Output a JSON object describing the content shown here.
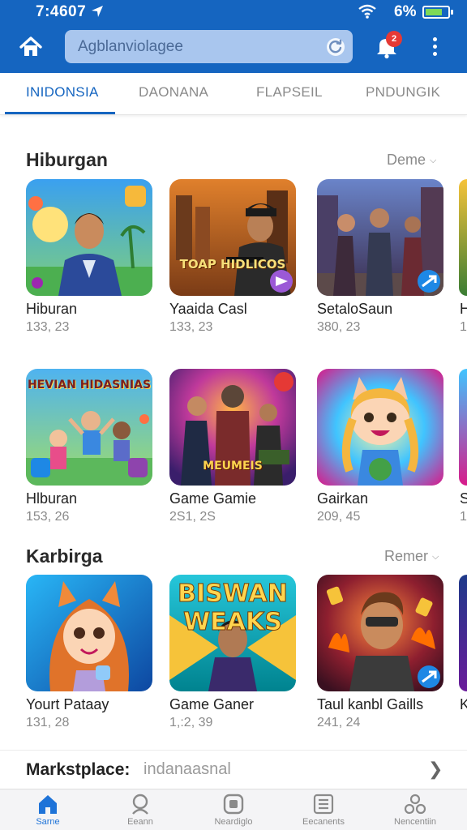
{
  "status": {
    "time": "7:4607",
    "battery": "6%"
  },
  "header": {
    "search_placeholder": "Agblanviolagee",
    "notification_count": "2"
  },
  "tabs": [
    {
      "label": "INIDONSIA",
      "active": true
    },
    {
      "label": "DAONANA",
      "active": false
    },
    {
      "label": "FLAPSEIL",
      "active": false
    },
    {
      "label": "PNDUNGIK",
      "active": false
    }
  ],
  "sections": [
    {
      "title": "Hiburgan",
      "more": "Deme",
      "rows": [
        [
          {
            "name": "Hiburan",
            "stat": "133, 23",
            "art": "man-suit-beach"
          },
          {
            "name": "Yaaida Casl",
            "stat": "133, 23",
            "art": "city-gunman",
            "overlay": "TOAP HIDLICOS"
          },
          {
            "name": "SetaloSaun",
            "stat": "380, 23",
            "art": "street-crew"
          }
        ],
        [
          {
            "name": "Hlburan",
            "stat": "153, 26",
            "art": "kids-cartoon",
            "overlay": "HEVIAN HIDASNIAS"
          },
          {
            "name": "Game Gamie",
            "stat": "2S1, 2S",
            "art": "action-squad",
            "overlay": "MEUMEIS"
          },
          {
            "name": "Gairkan",
            "stat": "209, 45",
            "art": "cat-girl"
          }
        ]
      ]
    },
    {
      "title": "Karbirga",
      "more": "Remer",
      "rows": [
        [
          {
            "name": "Yourt Pataay",
            "stat": "131, 28",
            "art": "fox-girl"
          },
          {
            "name": "Game Ganer",
            "stat": "1,:2, 39",
            "art": "slot-man",
            "overlay": "BISWAN WEAKS"
          },
          {
            "name": "Taul kanbl Gaills",
            "stat": "241, 24",
            "art": "card-man"
          }
        ]
      ]
    }
  ],
  "peek_stats": [
    "1",
    "1",
    ""
  ],
  "market": {
    "label": "Markstplace:",
    "value": "indanaasnal"
  },
  "bottom_nav": [
    {
      "label": "Sarne",
      "icon": "home-icon",
      "active": true
    },
    {
      "label": "Eeann",
      "icon": "search-person-icon",
      "active": false
    },
    {
      "label": "Neardiglo",
      "icon": "square-app-icon",
      "active": false
    },
    {
      "label": "Eecanents",
      "icon": "list-icon",
      "active": false
    },
    {
      "label": "Nencentiin",
      "icon": "circles-icon",
      "active": false
    }
  ],
  "colors": {
    "brand": "#1565c0",
    "search_bg": "#a9c6ee",
    "badge": "#e53935"
  }
}
